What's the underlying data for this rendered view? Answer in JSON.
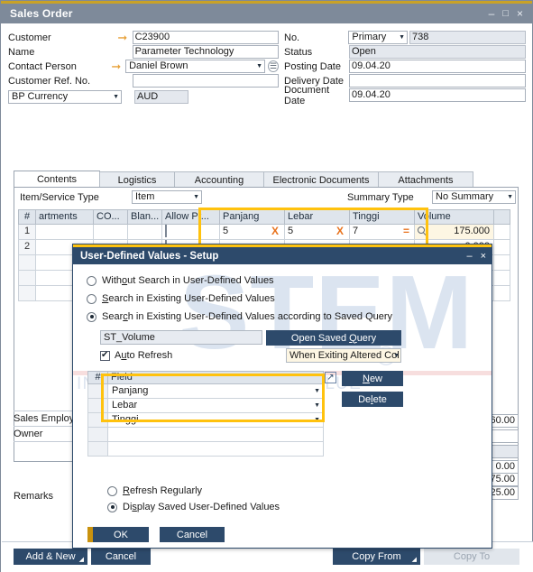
{
  "window": {
    "title": "Sales Order",
    "minimize_label": "–",
    "maximize_label": "□",
    "close_label": "×"
  },
  "header": {
    "left_fields": [
      {
        "label": "Customer",
        "arrow": true,
        "value": "C23900",
        "type": "input",
        "readonly": false
      },
      {
        "label": "Name",
        "arrow": false,
        "value": "Parameter Technology",
        "type": "input",
        "readonly": false
      },
      {
        "label": "Contact Person",
        "arrow": true,
        "value": "Daniel Brown",
        "type": "select",
        "readonly": false
      },
      {
        "label": "Customer Ref. No.",
        "arrow": false,
        "value": "",
        "type": "input",
        "readonly": false
      }
    ],
    "currency": {
      "label": "BP Currency",
      "value": "AUD"
    },
    "right_fields": [
      {
        "label": "No.",
        "select": "Primary",
        "value": "738",
        "readonly": true
      },
      {
        "label": "Status",
        "select": null,
        "value": "Open",
        "readonly": true
      },
      {
        "label": "Posting Date",
        "select": null,
        "value": "09.04.20",
        "readonly": false
      },
      {
        "label": "Delivery Date",
        "select": null,
        "value": "",
        "readonly": false
      },
      {
        "label": "Document Date",
        "select": null,
        "value": "09.04.20",
        "readonly": false
      }
    ]
  },
  "tabs": [
    {
      "label": "Contents",
      "active": true
    },
    {
      "label": "Logistics",
      "active": false
    },
    {
      "label": "Accounting",
      "active": false
    },
    {
      "label": "Electronic Documents",
      "active": false
    },
    {
      "label": "Attachments",
      "active": false
    }
  ],
  "contents": {
    "item_service_type_label": "Item/Service Type",
    "item_service_type_value": "Item",
    "summary_type_label": "Summary Type",
    "summary_type_value": "No Summary",
    "grid_headers": [
      "#",
      "artments",
      "CO...",
      "Blan...",
      "Allow Pr...",
      "Panjang",
      "Lebar",
      "Tinggi",
      "Volume",
      ""
    ],
    "grid_rows": [
      {
        "num": "1",
        "artments": "",
        "co": "",
        "blan": "",
        "allow_pr_checked": false,
        "panjang": "5",
        "panjang_op": "X",
        "lebar": "5",
        "lebar_op": "X",
        "tinggi": "7",
        "tinggi_op": "=",
        "volume": "175.000",
        "volume_search": true
      },
      {
        "num": "2",
        "artments": "",
        "co": "",
        "blan": "",
        "allow_pr_checked": false,
        "panjang": "",
        "panjang_op": "",
        "lebar": "",
        "lebar_op": "",
        "tinggi": "",
        "tinggi_op": "",
        "volume": "0.000",
        "volume_search": false
      }
    ]
  },
  "footer_form": {
    "sales_employee_label": "Sales Employee",
    "owner_label": "Owner",
    "remarks_label": "Remarks",
    "totals": [
      "60.00",
      "",
      "",
      "0.00",
      "75.00",
      "25.00"
    ]
  },
  "bottom_buttons": {
    "add_and_new": "Add & New",
    "cancel": "Cancel",
    "copy_from": "Copy From",
    "copy_to": "Copy To"
  },
  "dialog": {
    "title": "User-Defined Values - Setup",
    "minimize_label": "–",
    "close_label": "×",
    "options": [
      {
        "label_pre": "With",
        "label_key": "o",
        "label_post": "ut Search in User-Defined Values",
        "selected": false
      },
      {
        "label_pre": "",
        "label_key": "S",
        "label_post": "earch in Existing User-Defined Values",
        "selected": false
      },
      {
        "label_pre": "Sear",
        "label_key": "c",
        "label_post": "h in Existing User-Defined Values according to Saved Query",
        "selected": true
      }
    ],
    "query_name": "ST_Volume",
    "open_saved_query_button": "Open Saved Query",
    "auto_refresh_label_pre": "A",
    "auto_refresh_key": "u",
    "auto_refresh_label_post": "to Refresh",
    "auto_refresh_checked": true,
    "refresh_when_value": "When Exiting Altered Col",
    "field_table_headers": [
      "#",
      "Field"
    ],
    "field_rows": [
      {
        "num": "",
        "field": "Panjang",
        "has_dropdown": true
      },
      {
        "num": "",
        "field": "Lebar",
        "has_dropdown": true
      },
      {
        "num": "",
        "field": "Tinggi",
        "has_dropdown": true
      },
      {
        "num": "",
        "field": "",
        "has_dropdown": false
      },
      {
        "num": "",
        "field": "",
        "has_dropdown": false
      }
    ],
    "new_button": "New",
    "new_button_key": "N",
    "delete_button": "Delete",
    "delete_button_key": "l",
    "display_options": [
      {
        "label_pre": "",
        "label_key": "R",
        "label_post": "efresh Regularly",
        "selected": false
      },
      {
        "label_pre": "Di",
        "label_key": "s",
        "label_post": "play Saved User-Defined Values",
        "selected": true
      }
    ],
    "ok_button": "OK",
    "cancel_button": "Cancel"
  },
  "watermark": {
    "brand": "STEM",
    "registered": "®",
    "tagline": "INNOVATION  •  DESIGN  •  VALUE"
  },
  "colors": {
    "title_bar": "#7e8a9a",
    "dialog_title_bar": "#2d4a6b",
    "accent_gold": "#ffc20e",
    "operator_orange": "#e8721c",
    "button_navy": "#2d4a6b"
  }
}
